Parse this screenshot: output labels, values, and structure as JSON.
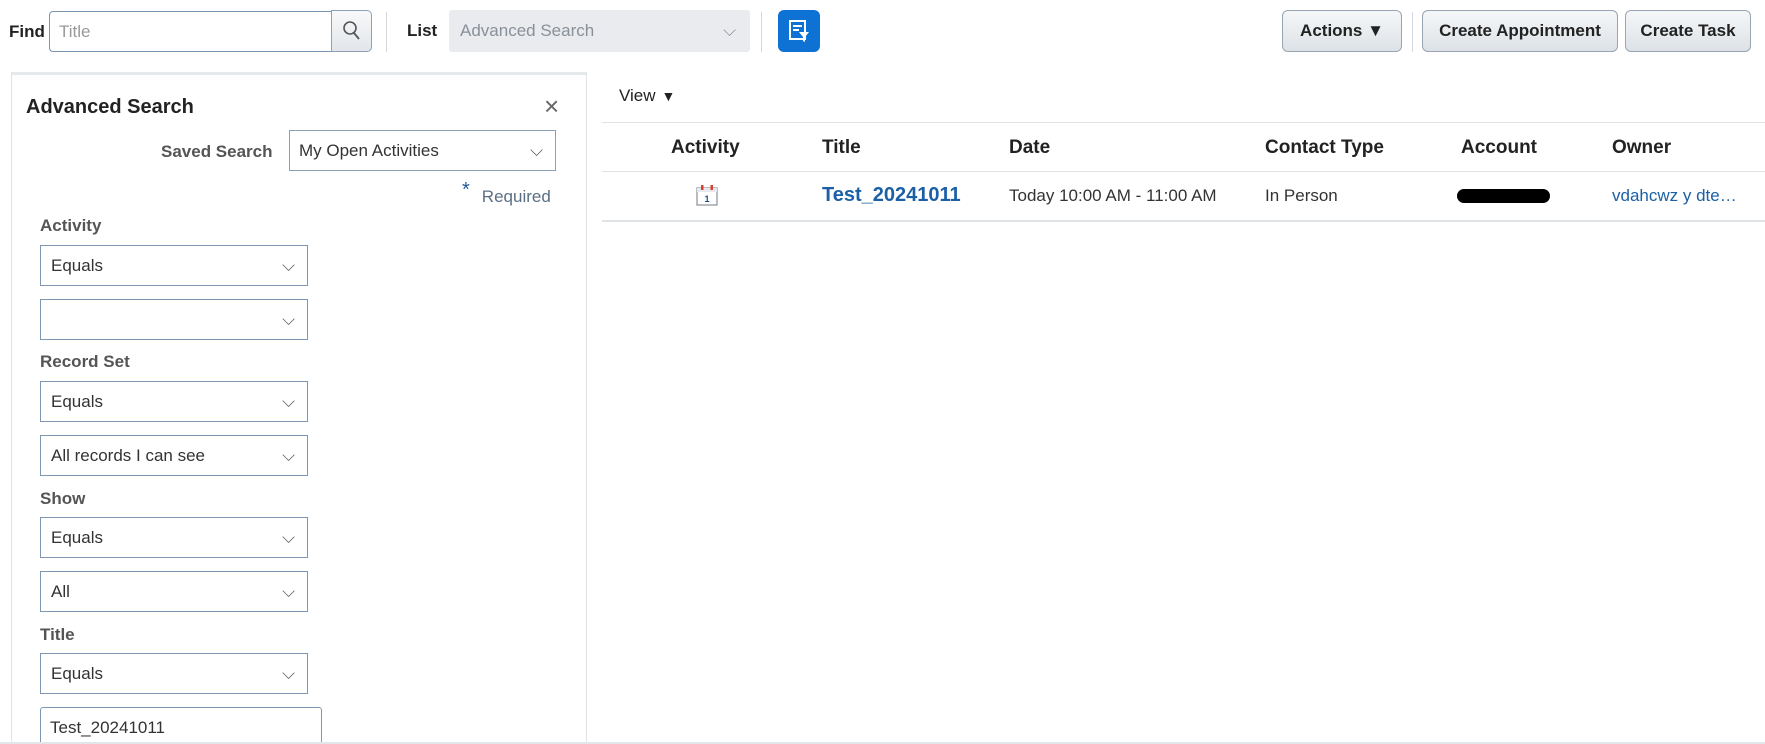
{
  "toolbar": {
    "find_label": "Find",
    "find_placeholder": "Title",
    "list_label": "List",
    "list_value": "Advanced Search",
    "actions_label": "Actions ▼",
    "create_appointment_label": "Create Appointment",
    "create_task_label": "Create Task"
  },
  "panel": {
    "title": "Advanced Search",
    "close_glyph": "×",
    "saved_search_label": "Saved Search",
    "saved_search_value": "My Open Activities",
    "required_star": "*",
    "required_label": "Required",
    "fields": [
      {
        "label": "Activity",
        "operator": "Equals",
        "value": ""
      },
      {
        "label": "Record Set",
        "operator": "Equals",
        "value": "All records I can see"
      },
      {
        "label": "Show",
        "operator": "Equals",
        "value": "All"
      },
      {
        "label": "Title",
        "operator": "Equals",
        "value": "Test_20241011"
      }
    ]
  },
  "results": {
    "view_label": "View",
    "columns": [
      "Activity",
      "Title",
      "Date",
      "Contact Type",
      "Account",
      "Owner"
    ],
    "rows": [
      {
        "activity_icon": "calendar-icon",
        "title": "Test_20241011",
        "date": "Today 10:00 AM - 11:00 AM",
        "contact_type": "In Person",
        "account": "",
        "owner": "vdahcwz y dte…"
      }
    ]
  },
  "colors": {
    "accent": "#0d72d4",
    "link": "#1b60a6"
  }
}
